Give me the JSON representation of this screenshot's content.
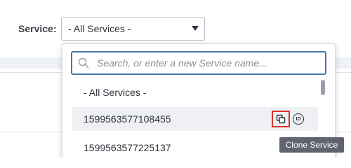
{
  "filter": {
    "label": "Service:",
    "selected": "- All Services -"
  },
  "dropdown": {
    "search_placeholder": "Search, or enter a new Service name...",
    "options": [
      {
        "label": "- All Services -"
      },
      {
        "label": "1599563577108455"
      },
      {
        "label": "1599563577225137"
      }
    ]
  },
  "tooltip": {
    "text": "Clone Service"
  },
  "id_badge": {
    "text": "ID"
  },
  "colors": {
    "search_border": "#4a74ad",
    "highlight_border": "#d9302c",
    "hover_row": "#eef0f4",
    "tooltip_bg": "#5f6470"
  },
  "icons": [
    "search-icon",
    "chevron-down-icon",
    "clone-icon",
    "id-icon"
  ]
}
